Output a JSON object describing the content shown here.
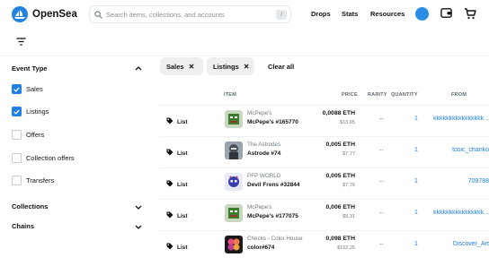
{
  "header": {
    "brand": "OpenSea",
    "search_placeholder": "Search items, collections, and accounts",
    "search_shortcut": "/",
    "nav": {
      "drops": "Drops",
      "stats": "Stats",
      "resources": "Resources"
    }
  },
  "sidebar": {
    "event_type_title": "Event Type",
    "event_types": [
      {
        "label": "Sales",
        "checked": true
      },
      {
        "label": "Listings",
        "checked": true
      },
      {
        "label": "Offers",
        "checked": false
      },
      {
        "label": "Collection offers",
        "checked": false
      },
      {
        "label": "Transfers",
        "checked": false
      }
    ],
    "collections_title": "Collections",
    "chains_title": "Chains"
  },
  "filters": {
    "chips": [
      "Sales",
      "Listings"
    ],
    "clear_all": "Clear all"
  },
  "table": {
    "headers": {
      "item": "ITEM",
      "price": "PRICE",
      "rarity": "RARITY",
      "quantity": "QUANTITY",
      "from": "FROM"
    },
    "rows": [
      {
        "event": "List",
        "collection": "McPepe's",
        "name": "McPepe's #165770",
        "price_eth": "0,0088 ETH",
        "price_usd": "$13,65",
        "rarity": "--",
        "quantity": "1",
        "from": "kkkkkkkkkkkkkkkk...",
        "thumb": "pepe"
      },
      {
        "event": "List",
        "collection": "The Astrodes",
        "name": "Astrode #74",
        "price_eth": "0,005 ETH",
        "price_usd": "$7,77",
        "rarity": "--",
        "quantity": "1",
        "from": "tosic_chanko",
        "thumb": "astrode"
      },
      {
        "event": "List",
        "collection": "PFP WORLD",
        "name": "Devil Frens #32844",
        "price_eth": "0,005 ETH",
        "price_usd": "$7,76",
        "rarity": "--",
        "quantity": "1",
        "from": "709788",
        "thumb": "pfp"
      },
      {
        "event": "List",
        "collection": "McPepe's",
        "name": "McPepe's #177075",
        "price_eth": "0,006 ETH",
        "price_usd": "$9,31",
        "rarity": "--",
        "quantity": "1",
        "from": "kkkkkkkkkkkkkkkk...",
        "thumb": "pepe"
      },
      {
        "event": "List",
        "collection": "Checks - Color House",
        "name": "color#674",
        "price_eth": "0,098 ETH",
        "price_usd": "$152,25",
        "rarity": "--",
        "quantity": "1",
        "from": "Discover_Art",
        "thumb": "checks"
      }
    ]
  },
  "colors": {
    "accent": "#2081e2",
    "chip_bg": "#eeeff0",
    "muted": "#707a83"
  }
}
